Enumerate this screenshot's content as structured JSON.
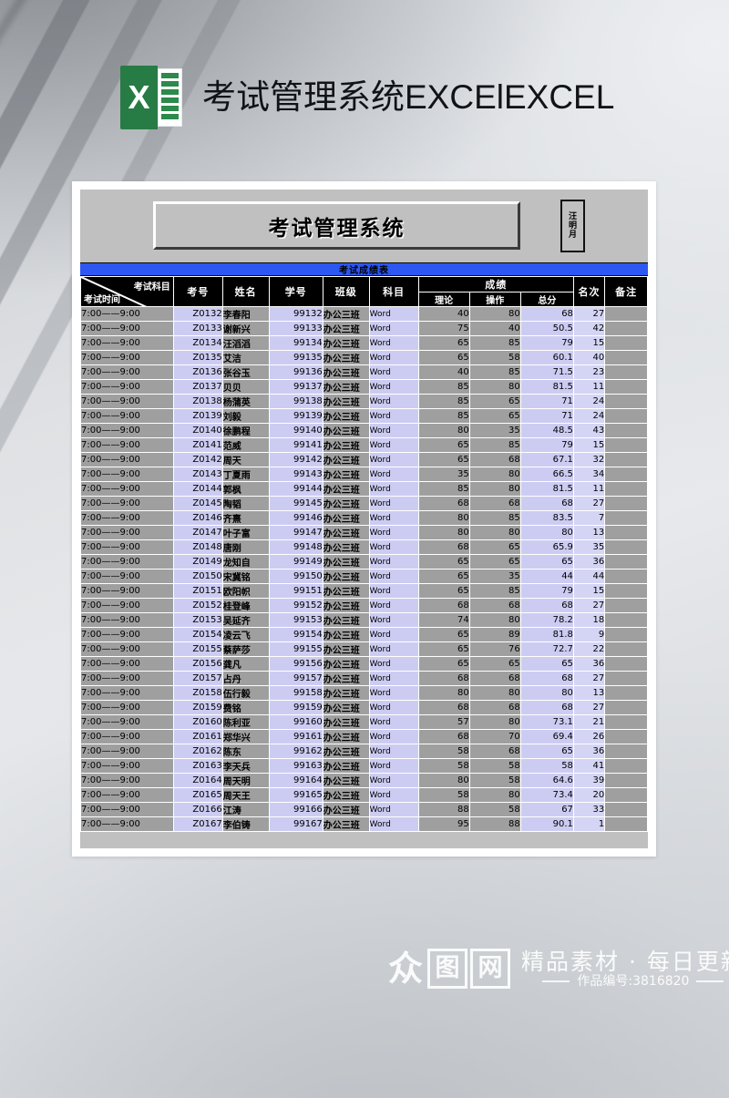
{
  "page_header": {
    "logo_letter": "X",
    "title": "考试管理系统EXCElEXCEL"
  },
  "sheet": {
    "title_box": "考试管理系统",
    "stamp_chars": [
      "汪",
      "明",
      "月"
    ],
    "section_title": "考试成绩表"
  },
  "colors": {
    "blue_bar": "#2d57f2",
    "header_black": "#000000",
    "sheet_gray": "#c0c0c0",
    "cell_gray": "#9f9f9f",
    "cell_lavender": "#ccccf2",
    "excel_green": "#267c44"
  },
  "table": {
    "corner": {
      "top_label": "考试科目",
      "bottom_label": "考试时间"
    },
    "columns": [
      {
        "key": "time",
        "label": ""
      },
      {
        "key": "exam_no",
        "label": "考号"
      },
      {
        "key": "name",
        "label": "姓名"
      },
      {
        "key": "student_no",
        "label": "学号"
      },
      {
        "key": "class",
        "label": "班级"
      },
      {
        "key": "subject",
        "label": "科目"
      },
      {
        "key": "theory",
        "label": "理论"
      },
      {
        "key": "practice",
        "label": "操作"
      },
      {
        "key": "total",
        "label": "总分"
      },
      {
        "key": "rank",
        "label": "名次"
      },
      {
        "key": "note",
        "label": "备注"
      }
    ],
    "score_group_label": "成绩",
    "rank_label": "名次",
    "note_label": "备注",
    "rows": [
      {
        "time": "7:00——9:00",
        "exam_no": "Z0132",
        "name": "李春阳",
        "student_no": "99132",
        "class": "办公三班",
        "subject": "Word",
        "theory": "40",
        "practice": "80",
        "total": "68",
        "rank": "27",
        "note": ""
      },
      {
        "time": "7:00——9:00",
        "exam_no": "Z0133",
        "name": "谢新兴",
        "student_no": "99133",
        "class": "办公三班",
        "subject": "Word",
        "theory": "75",
        "practice": "40",
        "total": "50.5",
        "rank": "42",
        "note": ""
      },
      {
        "time": "7:00——9:00",
        "exam_no": "Z0134",
        "name": "汪滔滔",
        "student_no": "99134",
        "class": "办公三班",
        "subject": "Word",
        "theory": "65",
        "practice": "85",
        "total": "79",
        "rank": "15",
        "note": ""
      },
      {
        "time": "7:00——9:00",
        "exam_no": "Z0135",
        "name": "艾洁",
        "student_no": "99135",
        "class": "办公三班",
        "subject": "Word",
        "theory": "65",
        "practice": "58",
        "total": "60.1",
        "rank": "40",
        "note": ""
      },
      {
        "time": "7:00——9:00",
        "exam_no": "Z0136",
        "name": "张谷玉",
        "student_no": "99136",
        "class": "办公三班",
        "subject": "Word",
        "theory": "40",
        "practice": "85",
        "total": "71.5",
        "rank": "23",
        "note": ""
      },
      {
        "time": "7:00——9:00",
        "exam_no": "Z0137",
        "name": "贝贝",
        "student_no": "99137",
        "class": "办公三班",
        "subject": "Word",
        "theory": "85",
        "practice": "80",
        "total": "81.5",
        "rank": "11",
        "note": ""
      },
      {
        "time": "7:00——9:00",
        "exam_no": "Z0138",
        "name": "杨蒲英",
        "student_no": "99138",
        "class": "办公三班",
        "subject": "Word",
        "theory": "85",
        "practice": "65",
        "total": "71",
        "rank": "24",
        "note": ""
      },
      {
        "time": "7:00——9:00",
        "exam_no": "Z0139",
        "name": "刘毅",
        "student_no": "99139",
        "class": "办公三班",
        "subject": "Word",
        "theory": "85",
        "practice": "65",
        "total": "71",
        "rank": "24",
        "note": ""
      },
      {
        "time": "7:00——9:00",
        "exam_no": "Z0140",
        "name": "徐鹏程",
        "student_no": "99140",
        "class": "办公三班",
        "subject": "Word",
        "theory": "80",
        "practice": "35",
        "total": "48.5",
        "rank": "43",
        "note": ""
      },
      {
        "time": "7:00——9:00",
        "exam_no": "Z0141",
        "name": "范威",
        "student_no": "99141",
        "class": "办公三班",
        "subject": "Word",
        "theory": "65",
        "practice": "85",
        "total": "79",
        "rank": "15",
        "note": ""
      },
      {
        "time": "7:00——9:00",
        "exam_no": "Z0142",
        "name": "周天",
        "student_no": "99142",
        "class": "办公三班",
        "subject": "Word",
        "theory": "65",
        "practice": "68",
        "total": "67.1",
        "rank": "32",
        "note": ""
      },
      {
        "time": "7:00——9:00",
        "exam_no": "Z0143",
        "name": "丁夏雨",
        "student_no": "99143",
        "class": "办公三班",
        "subject": "Word",
        "theory": "35",
        "practice": "80",
        "total": "66.5",
        "rank": "34",
        "note": ""
      },
      {
        "time": "7:00——9:00",
        "exam_no": "Z0144",
        "name": "郭枫",
        "student_no": "99144",
        "class": "办公三班",
        "subject": "Word",
        "theory": "85",
        "practice": "80",
        "total": "81.5",
        "rank": "11",
        "note": ""
      },
      {
        "time": "7:00——9:00",
        "exam_no": "Z0145",
        "name": "陶韬",
        "student_no": "99145",
        "class": "办公三班",
        "subject": "Word",
        "theory": "68",
        "practice": "68",
        "total": "68",
        "rank": "27",
        "note": ""
      },
      {
        "time": "7:00——9:00",
        "exam_no": "Z0146",
        "name": "齐熹",
        "student_no": "99146",
        "class": "办公三班",
        "subject": "Word",
        "theory": "80",
        "practice": "85",
        "total": "83.5",
        "rank": "7",
        "note": ""
      },
      {
        "time": "7:00——9:00",
        "exam_no": "Z0147",
        "name": "叶子富",
        "student_no": "99147",
        "class": "办公三班",
        "subject": "Word",
        "theory": "80",
        "practice": "80",
        "total": "80",
        "rank": "13",
        "note": ""
      },
      {
        "time": "7:00——9:00",
        "exam_no": "Z0148",
        "name": "唐刚",
        "student_no": "99148",
        "class": "办公三班",
        "subject": "Word",
        "theory": "68",
        "practice": "65",
        "total": "65.9",
        "rank": "35",
        "note": ""
      },
      {
        "time": "7:00——9:00",
        "exam_no": "Z0149",
        "name": "龙知自",
        "student_no": "99149",
        "class": "办公三班",
        "subject": "Word",
        "theory": "65",
        "practice": "65",
        "total": "65",
        "rank": "36",
        "note": ""
      },
      {
        "time": "7:00——9:00",
        "exam_no": "Z0150",
        "name": "宋冀铭",
        "student_no": "99150",
        "class": "办公三班",
        "subject": "Word",
        "theory": "65",
        "practice": "35",
        "total": "44",
        "rank": "44",
        "note": ""
      },
      {
        "time": "7:00——9:00",
        "exam_no": "Z0151",
        "name": "欧阳帜",
        "student_no": "99151",
        "class": "办公三班",
        "subject": "Word",
        "theory": "65",
        "practice": "85",
        "total": "79",
        "rank": "15",
        "note": ""
      },
      {
        "time": "7:00——9:00",
        "exam_no": "Z0152",
        "name": "桂登峰",
        "student_no": "99152",
        "class": "办公三班",
        "subject": "Word",
        "theory": "68",
        "practice": "68",
        "total": "68",
        "rank": "27",
        "note": ""
      },
      {
        "time": "7:00——9:00",
        "exam_no": "Z0153",
        "name": "吴延齐",
        "student_no": "99153",
        "class": "办公三班",
        "subject": "Word",
        "theory": "74",
        "practice": "80",
        "total": "78.2",
        "rank": "18",
        "note": ""
      },
      {
        "time": "7:00——9:00",
        "exam_no": "Z0154",
        "name": "凌云飞",
        "student_no": "99154",
        "class": "办公三班",
        "subject": "Word",
        "theory": "65",
        "practice": "89",
        "total": "81.8",
        "rank": "9",
        "note": ""
      },
      {
        "time": "7:00——9:00",
        "exam_no": "Z0155",
        "name": "蔡萨莎",
        "student_no": "99155",
        "class": "办公三班",
        "subject": "Word",
        "theory": "65",
        "practice": "76",
        "total": "72.7",
        "rank": "22",
        "note": ""
      },
      {
        "time": "7:00——9:00",
        "exam_no": "Z0156",
        "name": "龚凡",
        "student_no": "99156",
        "class": "办公三班",
        "subject": "Word",
        "theory": "65",
        "practice": "65",
        "total": "65",
        "rank": "36",
        "note": ""
      },
      {
        "time": "7:00——9:00",
        "exam_no": "Z0157",
        "name": "占丹",
        "student_no": "99157",
        "class": "办公三班",
        "subject": "Word",
        "theory": "68",
        "practice": "68",
        "total": "68",
        "rank": "27",
        "note": ""
      },
      {
        "time": "7:00——9:00",
        "exam_no": "Z0158",
        "name": "伍行毅",
        "student_no": "99158",
        "class": "办公三班",
        "subject": "Word",
        "theory": "80",
        "practice": "80",
        "total": "80",
        "rank": "13",
        "note": ""
      },
      {
        "time": "7:00——9:00",
        "exam_no": "Z0159",
        "name": "费铭",
        "student_no": "99159",
        "class": "办公三班",
        "subject": "Word",
        "theory": "68",
        "practice": "68",
        "total": "68",
        "rank": "27",
        "note": ""
      },
      {
        "time": "7:00——9:00",
        "exam_no": "Z0160",
        "name": "陈利亚",
        "student_no": "99160",
        "class": "办公三班",
        "subject": "Word",
        "theory": "57",
        "practice": "80",
        "total": "73.1",
        "rank": "21",
        "note": ""
      },
      {
        "time": "7:00——9:00",
        "exam_no": "Z0161",
        "name": "郑华兴",
        "student_no": "99161",
        "class": "办公三班",
        "subject": "Word",
        "theory": "68",
        "practice": "70",
        "total": "69.4",
        "rank": "26",
        "note": ""
      },
      {
        "time": "7:00——9:00",
        "exam_no": "Z0162",
        "name": "陈东",
        "student_no": "99162",
        "class": "办公三班",
        "subject": "Word",
        "theory": "58",
        "practice": "68",
        "total": "65",
        "rank": "36",
        "note": ""
      },
      {
        "time": "7:00——9:00",
        "exam_no": "Z0163",
        "name": "李天兵",
        "student_no": "99163",
        "class": "办公三班",
        "subject": "Word",
        "theory": "58",
        "practice": "58",
        "total": "58",
        "rank": "41",
        "note": ""
      },
      {
        "time": "7:00——9:00",
        "exam_no": "Z0164",
        "name": "周天明",
        "student_no": "99164",
        "class": "办公三班",
        "subject": "Word",
        "theory": "80",
        "practice": "58",
        "total": "64.6",
        "rank": "39",
        "note": ""
      },
      {
        "time": "7:00——9:00",
        "exam_no": "Z0165",
        "name": "周天王",
        "student_no": "99165",
        "class": "办公三班",
        "subject": "Word",
        "theory": "58",
        "practice": "80",
        "total": "73.4",
        "rank": "20",
        "note": ""
      },
      {
        "time": "7:00——9:00",
        "exam_no": "Z0166",
        "name": "江涛",
        "student_no": "99166",
        "class": "办公三班",
        "subject": "Word",
        "theory": "88",
        "practice": "58",
        "total": "67",
        "rank": "33",
        "note": ""
      },
      {
        "time": "7:00——9:00",
        "exam_no": "Z0167",
        "name": "李伯铸",
        "student_no": "99167",
        "class": "办公三班",
        "subject": "Word",
        "theory": "95",
        "practice": "88",
        "total": "90.1",
        "rank": "1",
        "note": ""
      }
    ]
  },
  "watermark": {
    "logo_chars": [
      "众",
      "图",
      "网"
    ],
    "tagline": "精品素材 · 每日更新",
    "work_id": "作品编号:3816820"
  }
}
